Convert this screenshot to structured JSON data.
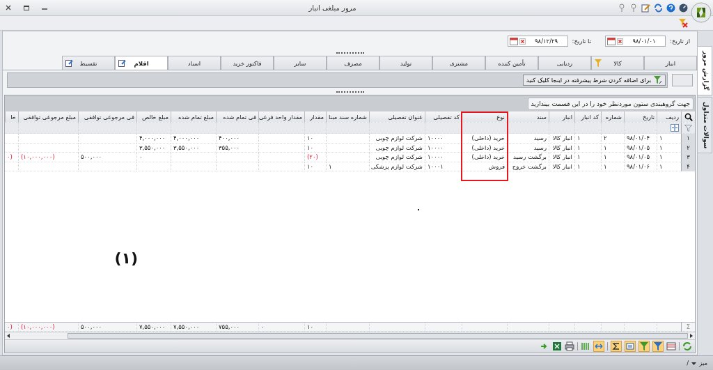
{
  "window": {
    "title": "مرور مبلغی انبار"
  },
  "date_range": {
    "from_label": "از تاریخ:",
    "from_value": "۹۸/۰۱/۰۱",
    "to_label": "تا تاریخ:",
    "to_value": "۹۸/۱۲/۲۹"
  },
  "side_tabs": [
    {
      "label": "گزارش مرور",
      "selected": true
    },
    {
      "label": "سوالات متداول",
      "selected": false
    }
  ],
  "tabs": [
    {
      "label": "انبار",
      "selected": false,
      "kind": "plain"
    },
    {
      "label": "کالا",
      "selected": false,
      "kind": "filtered"
    },
    {
      "label": "ردیابی",
      "selected": false,
      "kind": "plain"
    },
    {
      "label": "تأمین کننده",
      "selected": false,
      "kind": "plain"
    },
    {
      "label": "مشتری",
      "selected": false,
      "kind": "plain"
    },
    {
      "label": "تولید",
      "selected": false,
      "kind": "plain"
    },
    {
      "label": "مصرف",
      "selected": false,
      "kind": "plain"
    },
    {
      "label": "سایر",
      "selected": false,
      "kind": "plain"
    },
    {
      "label": "فاکتور خرید",
      "selected": false,
      "kind": "plain"
    },
    {
      "label": "اسناد",
      "selected": false,
      "kind": "plain"
    },
    {
      "label": "اقلام",
      "selected": true,
      "kind": "editable"
    },
    {
      "label": "تقسیط",
      "selected": false,
      "kind": "editable"
    }
  ],
  "filter_bar": {
    "button": "برای اضافه کردن شرط پیشرفته در اینجا کلیک کنید"
  },
  "group_panel": {
    "hint": "جهت گروهبندی ستون موردنظر خود را در این قسمت بیندازید"
  },
  "table": {
    "columns": [
      "ردیف",
      "تاریخ",
      "شماره",
      "کد انبار",
      "انبار",
      "سند",
      "نوع",
      "کد تفصیلی",
      "عنوان تفصیلی",
      "شماره سند مبنا",
      "مقدار",
      "مقدار واحد فرعی",
      "فی تمام شده",
      "مبلغ تمام شده",
      "مبلغ خالص",
      "فی مرجوعی توافقی",
      "مبلغ مرجوعی توافقی",
      "خا"
    ],
    "rows": [
      {
        "number": "۱",
        "cells": [
          {
            "text": "۱",
            "negative": false
          },
          {
            "text": "۹۸/۰۱/۰۴",
            "negative": false
          },
          {
            "text": "۲",
            "negative": false
          },
          {
            "text": "۱",
            "negative": false
          },
          {
            "text": "انبار کالا",
            "negative": false
          },
          {
            "text": "رسید",
            "negative": false
          },
          {
            "text": "خرید (داخلی)",
            "negative": false
          },
          {
            "text": "۱۰۰۰۰",
            "negative": false
          },
          {
            "text": "شرکت لوازم چوبی",
            "negative": false
          },
          null,
          {
            "text": "۱۰",
            "negative": false
          },
          null,
          {
            "text": "۴۰۰,۰۰۰",
            "negative": false
          },
          {
            "text": "۴,۰۰۰,۰۰۰",
            "negative": false
          },
          {
            "text": "۴,۰۰۰,۰۰۰",
            "negative": false
          },
          null,
          null,
          null
        ]
      },
      {
        "number": "۲",
        "cells": [
          {
            "text": "۱",
            "negative": false
          },
          {
            "text": "۹۸/۰۱/۰۵",
            "negative": false
          },
          {
            "text": "۱",
            "negative": false
          },
          {
            "text": "۱",
            "negative": false
          },
          {
            "text": "انبار کالا",
            "negative": false
          },
          {
            "text": "رسید",
            "negative": false
          },
          {
            "text": "خرید (داخلی)",
            "negative": false
          },
          {
            "text": "۱۰۰۰۰",
            "negative": false
          },
          {
            "text": "شرکت لوازم چوبی",
            "negative": false
          },
          null,
          {
            "text": "۱۰",
            "negative": false
          },
          null,
          {
            "text": "۳۵۵,۰۰۰",
            "negative": false
          },
          {
            "text": "۳,۵۵۰,۰۰۰",
            "negative": false
          },
          {
            "text": "۳,۵۵۰,۰۰۰",
            "negative": false
          },
          null,
          null,
          null
        ]
      },
      {
        "number": "۳",
        "cells": [
          {
            "text": "۱",
            "negative": false
          },
          {
            "text": "۹۸/۰۱/۰۵",
            "negative": false
          },
          {
            "text": "۱",
            "negative": false
          },
          {
            "text": "۱",
            "negative": false
          },
          {
            "text": "انبار کالا",
            "negative": false
          },
          {
            "text": "برگشت رسید",
            "negative": false
          },
          {
            "text": "خرید (داخلی)",
            "negative": false
          },
          {
            "text": "۱۰۰۰۰",
            "negative": false
          },
          {
            "text": "شرکت لوازم چوبی",
            "negative": false
          },
          null,
          {
            "text": "(۲۰)",
            "negative": true
          },
          null,
          null,
          null,
          {
            "text": "۰"
          },
          {
            "text": "۵۰۰,۰۰۰",
            "negative": false
          },
          {
            "text": "(۱۰,۰۰۰,۰۰۰)",
            "negative": true
          },
          {
            "text": "۰)",
            "negative": true
          }
        ]
      },
      {
        "number": "۴",
        "cells": [
          {
            "text": "۱",
            "negative": false
          },
          {
            "text": "۹۸/۰۱/۰۶",
            "negative": false
          },
          {
            "text": "۱",
            "negative": false
          },
          {
            "text": "۱",
            "negative": false
          },
          {
            "text": "انبار کالا",
            "negative": false
          },
          {
            "text": "برگشت خروج",
            "negative": false
          },
          {
            "text": "فروش",
            "negative": false
          },
          {
            "text": "۱۰۰۰۱",
            "negative": false
          },
          {
            "text": "شرکت لوازم پزشکی",
            "negative": false
          },
          {
            "text": "۱",
            "negative": false
          },
          {
            "text": "۱۰",
            "negative": false
          },
          null,
          null,
          null,
          null,
          null,
          null,
          null
        ]
      }
    ],
    "totals": {
      "symbol": "Σ",
      "cells": [
        null,
        null,
        null,
        null,
        null,
        null,
        null,
        null,
        null,
        null,
        {
          "text": "۱۰",
          "negative": false
        },
        {
          "text": "۰"
        },
        {
          "text": "۷۵۵,۰۰۰",
          "negative": false
        },
        {
          "text": "۷,۵۵۰,۰۰۰",
          "negative": false
        },
        {
          "text": "۷,۵۵۰,۰۰۰",
          "negative": false
        },
        {
          "text": "۵۰۰,۰۰۰",
          "negative": false
        },
        {
          "text": "(۱۰,۰۰۰,۰۰۰)",
          "negative": true
        },
        {
          "text": "۰)",
          "negative": true
        }
      ]
    }
  },
  "annotation": {
    "label": "(۱)"
  },
  "status_bar": {
    "label": "میز",
    "path": "/"
  }
}
